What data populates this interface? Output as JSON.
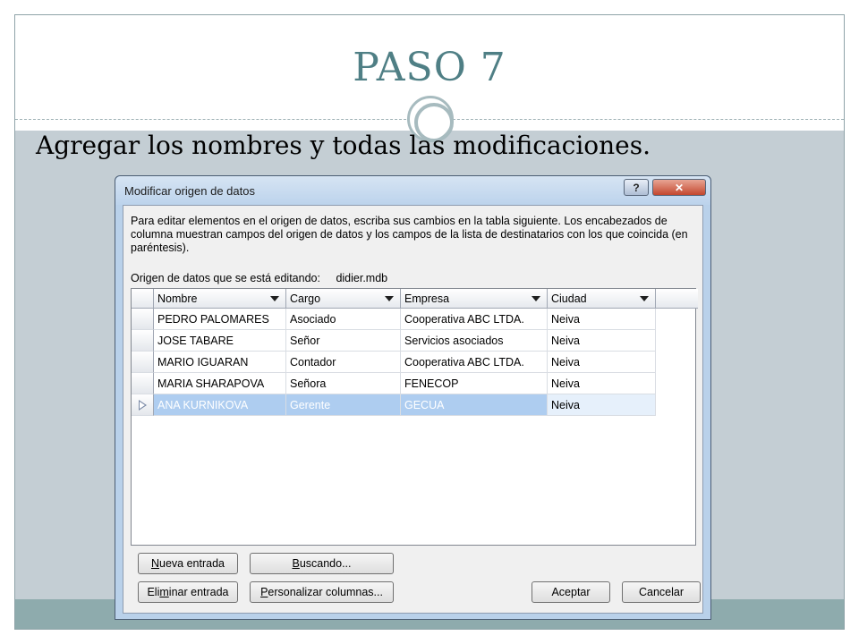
{
  "slide": {
    "title": "PASO 7",
    "subtitle": "Agregar los nombres y todas las modificaciones."
  },
  "dialog": {
    "title": "Modificar origen de datos",
    "help_label": "?",
    "close_label": "✕",
    "description": "Para editar elementos en el origen de datos, escriba sus cambios en la tabla siguiente. Los encabezados de columna muestran campos del origen de datos y los campos de la lista de destinatarios con los que coincida (en paréntesis).",
    "source_label": "Origen de datos que se está editando:",
    "source_file": "didier.mdb",
    "columns": [
      "Nombre",
      "Cargo",
      "Empresa",
      "Ciudad"
    ],
    "rows": [
      [
        "PEDRO PALOMARES",
        "Asociado",
        "Cooperativa ABC LTDA.",
        "Neiva"
      ],
      [
        "JOSE TABARE",
        "Señor",
        "Servicios asociados",
        "Neiva"
      ],
      [
        "MARIO IGUARAN",
        "Contador",
        "Cooperativa ABC LTDA.",
        "Neiva"
      ],
      [
        "MARIA SHARAPOVA",
        "Señora",
        "FENECOP",
        "Neiva"
      ],
      [
        "ANA KURNIKOVA",
        "Gerente",
        "GECUA",
        "Neiva"
      ]
    ],
    "buttons": {
      "new_entry": {
        "u": "N",
        "rest": "ueva entrada"
      },
      "search": {
        "u": "B",
        "rest": "uscando..."
      },
      "delete_entry": {
        "pre": "Eli",
        "u": "m",
        "rest": "inar entrada"
      },
      "customize": {
        "u": "P",
        "rest": "ersonalizar columnas..."
      },
      "accept": "Aceptar",
      "cancel": "Cancelar"
    }
  }
}
